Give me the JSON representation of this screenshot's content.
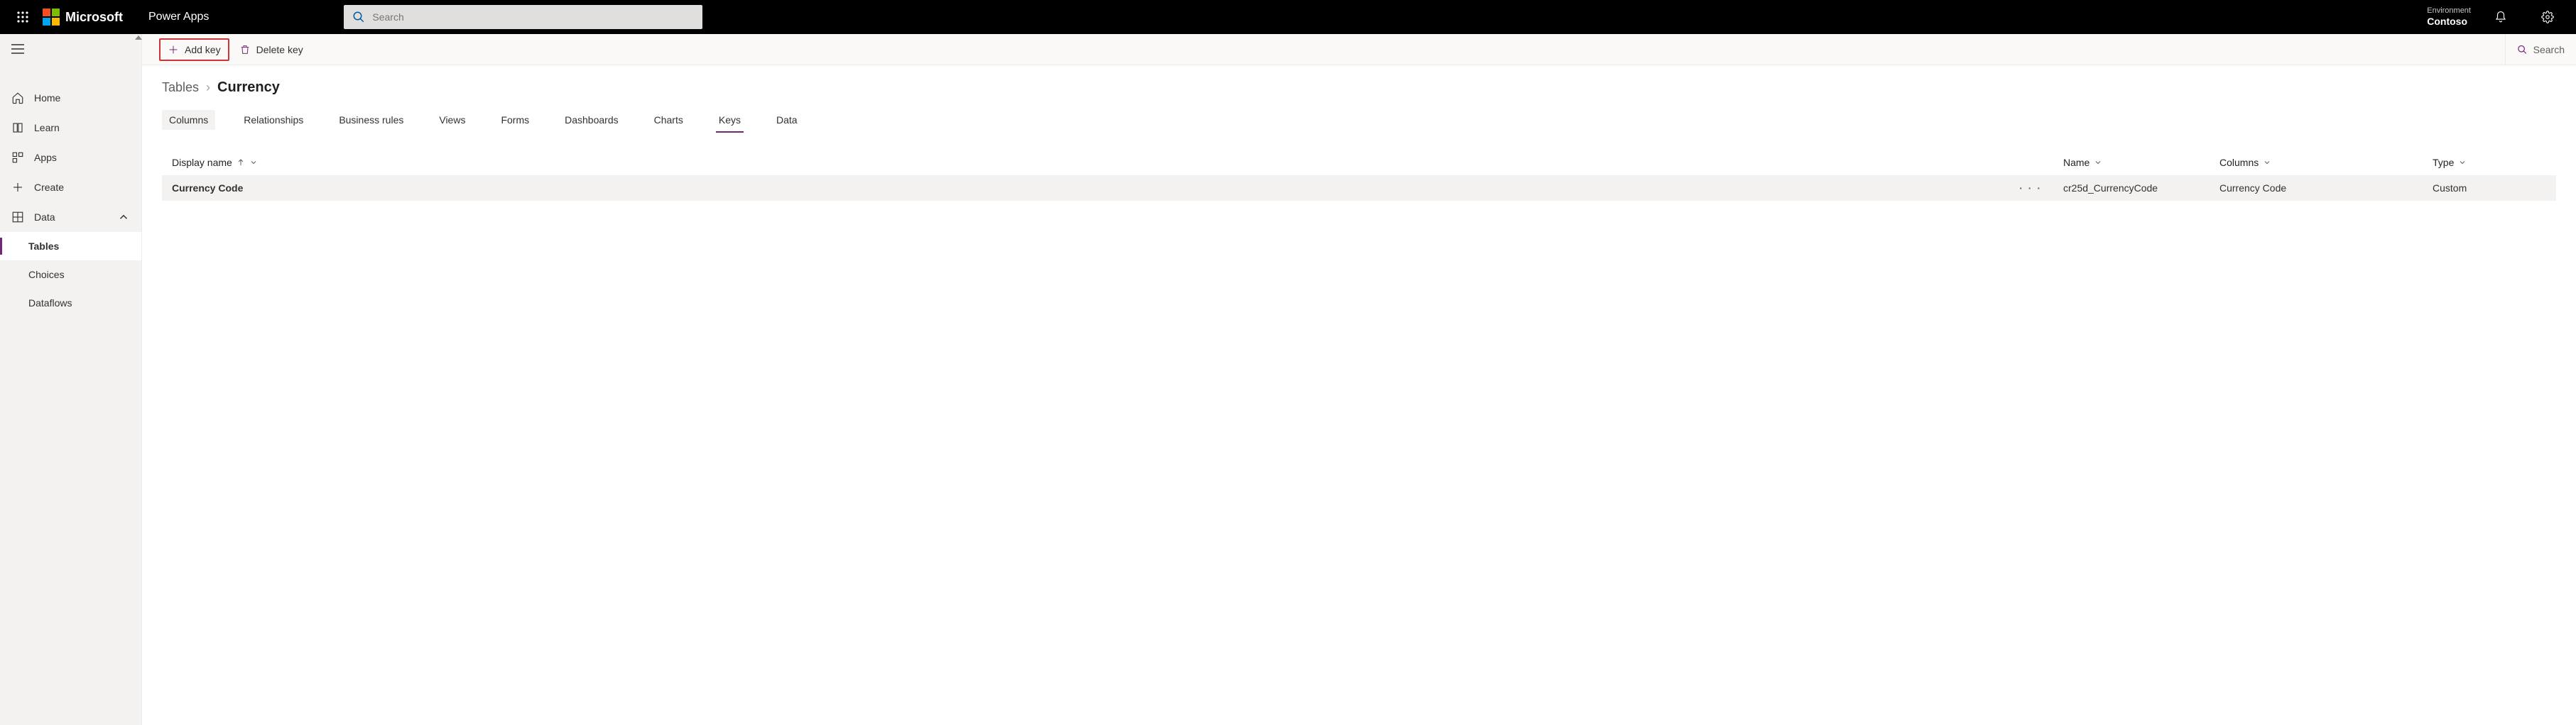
{
  "header": {
    "brand_text": "Microsoft",
    "app_title": "Power Apps",
    "search_placeholder": "Search",
    "environment_label": "Environment",
    "environment_name": "Contoso"
  },
  "sidebar": {
    "home": "Home",
    "learn": "Learn",
    "apps": "Apps",
    "create": "Create",
    "data": "Data",
    "tables": "Tables",
    "choices": "Choices",
    "dataflows": "Dataflows"
  },
  "commands": {
    "add_key": "Add key",
    "delete_key": "Delete key",
    "search_placeholder": "Search"
  },
  "breadcrumb": {
    "parent": "Tables",
    "current": "Currency"
  },
  "tabs": {
    "columns": "Columns",
    "relationships": "Relationships",
    "business_rules": "Business rules",
    "views": "Views",
    "forms": "Forms",
    "dashboards": "Dashboards",
    "charts": "Charts",
    "keys": "Keys",
    "data": "Data"
  },
  "columns_header": {
    "display_name": "Display name",
    "name": "Name",
    "columns": "Columns",
    "type": "Type"
  },
  "rows": [
    {
      "display_name": "Currency Code",
      "name": "cr25d_CurrencyCode",
      "columns": "Currency Code",
      "type": "Custom"
    }
  ]
}
